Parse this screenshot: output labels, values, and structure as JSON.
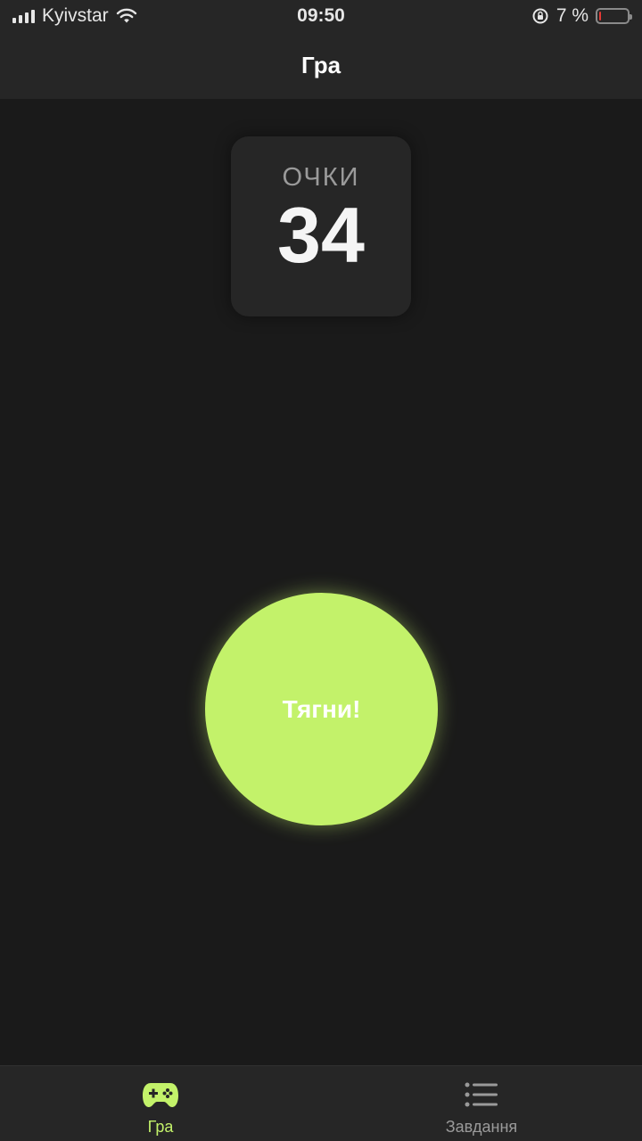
{
  "status_bar": {
    "carrier": "Kyivstar",
    "time": "09:50",
    "battery_text": "7 %",
    "battery_level": 0.07
  },
  "nav": {
    "title": "Гра"
  },
  "score": {
    "label": "ОЧКИ",
    "value": "34"
  },
  "action": {
    "pull_label": "Тягни!"
  },
  "tabs": [
    {
      "label": "Гра",
      "icon": "gamepad-icon",
      "active": true
    },
    {
      "label": "Завдання",
      "icon": "list-icon",
      "active": false
    }
  ],
  "colors": {
    "accent": "#c3f26a",
    "background": "#1a1a1a",
    "surface": "#262626",
    "battery_low": "#e53935"
  }
}
